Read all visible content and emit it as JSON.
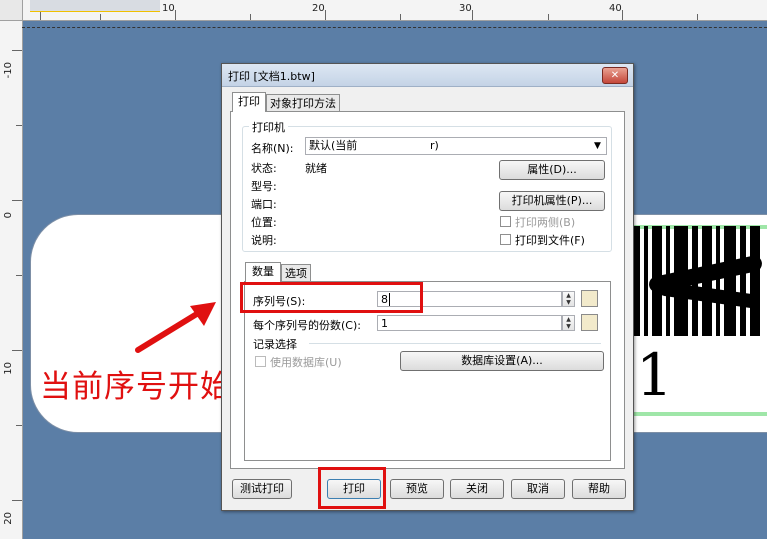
{
  "ruler": {
    "top_labels": [
      "10",
      "20",
      "30",
      "40"
    ],
    "left_labels": [
      "-10",
      "0",
      "10",
      "20"
    ]
  },
  "label_preview": {
    "serial_text": "1"
  },
  "annotation": {
    "text": "当前序号开始打多少个",
    "color": "#e01010"
  },
  "dialog": {
    "title": "打印 [文档1.btw]",
    "close_glyph": "✕",
    "tabs": [
      "打印",
      "对象打印方法"
    ],
    "printer_group": {
      "title": "打印机",
      "name_label": "名称(N):",
      "name_value": "默认(当前",
      "name_value_tail": "r)",
      "status_label": "状态:",
      "status_value": "就绪",
      "model_label": "型号:",
      "port_label": "端口:",
      "location_label": "位置:",
      "comment_label": "说明:",
      "properties_button": "属性(D)...",
      "printer_properties_button": "打印机属性(P)...",
      "print_both_sides": "打印两侧(B)",
      "print_to_file": "打印到文件(F)"
    },
    "sub_tabs": [
      "数量",
      "选项"
    ],
    "quantity": {
      "serial_label": "序列号(S):",
      "serial_value": "8",
      "copies_label": "每个序列号的份数(C):",
      "copies_value": "1"
    },
    "records": {
      "title": "记录选择",
      "use_database": "使用数据库(U)",
      "database_settings_button": "数据库设置(A)..."
    },
    "buttons": {
      "test_print": "测试打印",
      "print": "打印",
      "preview": "预览",
      "close": "关闭",
      "cancel": "取消",
      "help": "帮助"
    }
  }
}
